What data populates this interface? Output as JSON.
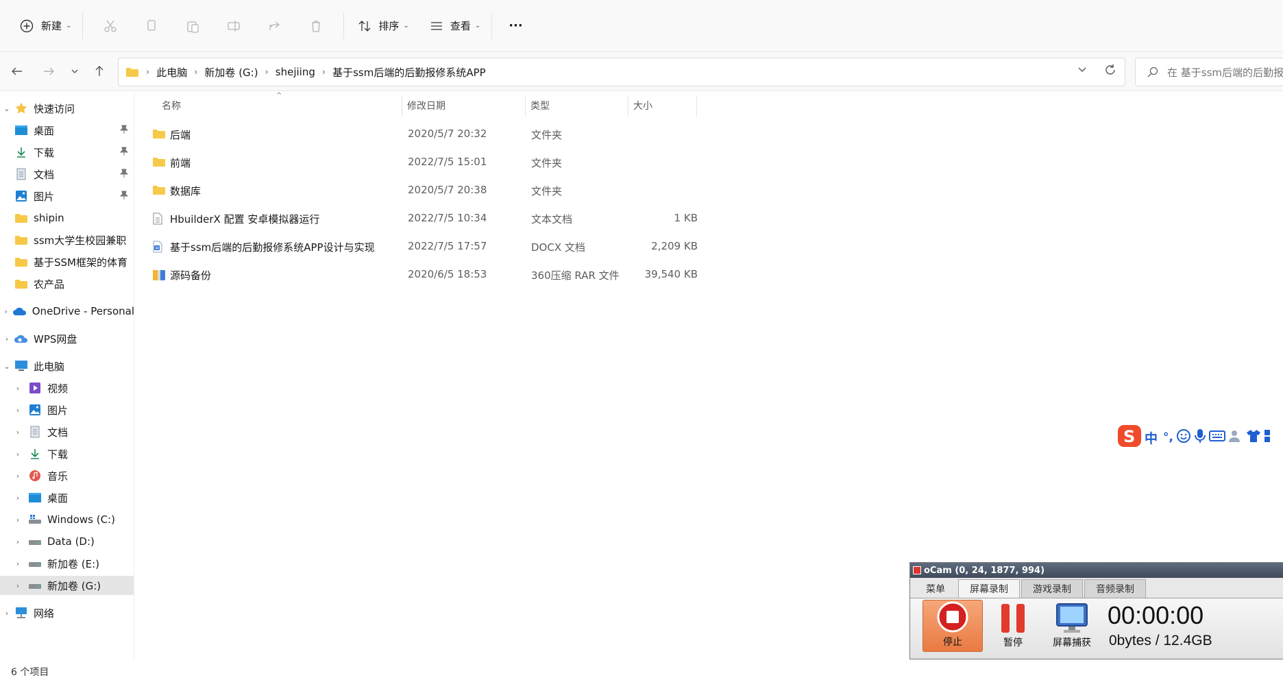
{
  "toolbar": {
    "new_label": "新建",
    "sort_label": "排序",
    "view_label": "查看",
    "more_label": "···"
  },
  "address": {
    "crumbs": [
      "此电脑",
      "新加卷 (G:)",
      "shejiing",
      "基于ssm后端的后勤报修系统APP"
    ],
    "search_placeholder": "在 基于ssm后端的后勤报修系统APP 中搜索"
  },
  "sidebar": {
    "quick_access": "快速访问",
    "quick_items": [
      "桌面",
      "下载",
      "文档",
      "图片",
      "shipin",
      "ssm大学生校园兼职",
      "基于SSM框架的体育",
      "农产品"
    ],
    "onedrive": "OneDrive - Personal",
    "wps": "WPS网盘",
    "this_pc": "此电脑",
    "pc_items": [
      "视频",
      "图片",
      "文档",
      "下载",
      "音乐",
      "桌面",
      "Windows (C:)",
      "Data (D:)",
      "新加卷 (E:)",
      "新加卷 (G:)"
    ],
    "network": "网络"
  },
  "columns": {
    "name": "名称",
    "date": "修改日期",
    "type": "类型",
    "size": "大小"
  },
  "files": [
    {
      "name": "后端",
      "date": "2020/5/7 20:32",
      "type": "文件夹",
      "size": "",
      "icon": "folder-icon"
    },
    {
      "name": "前端",
      "date": "2022/7/5 15:01",
      "type": "文件夹",
      "size": "",
      "icon": "folder-icon"
    },
    {
      "name": "数据库",
      "date": "2020/5/7 20:38",
      "type": "文件夹",
      "size": "",
      "icon": "folder-icon"
    },
    {
      "name": "HbuilderX 配置 安卓模拟器运行",
      "date": "2022/7/5 10:34",
      "type": "文本文档",
      "size": "1 KB",
      "icon": "text-file-icon"
    },
    {
      "name": "基于ssm后端的后勤报修系统APP设计与实现",
      "date": "2022/7/5 17:57",
      "type": "DOCX 文档",
      "size": "2,209 KB",
      "icon": "docx-file-icon"
    },
    {
      "name": "源码备份",
      "date": "2020/6/5 18:53",
      "type": "360压缩 RAR 文件",
      "size": "39,540 KB",
      "icon": "rar-file-icon"
    }
  ],
  "status": {
    "count": "6 个项目"
  },
  "ime": {
    "lang": "中",
    "punct": "°,"
  },
  "ocam": {
    "title": "oCam (0, 24, 1877, 994)",
    "tabs": [
      "菜单",
      "屏幕录制",
      "游戏录制",
      "音频录制"
    ],
    "stop": "停止",
    "pause": "暂停",
    "capture": "屏幕捕获",
    "timer": "00:00:00",
    "bytes": "0bytes / 12.4GB"
  },
  "colors": {
    "folder": "#f7c948",
    "accent": "#0067c0",
    "selected": "#e5e5e5"
  }
}
